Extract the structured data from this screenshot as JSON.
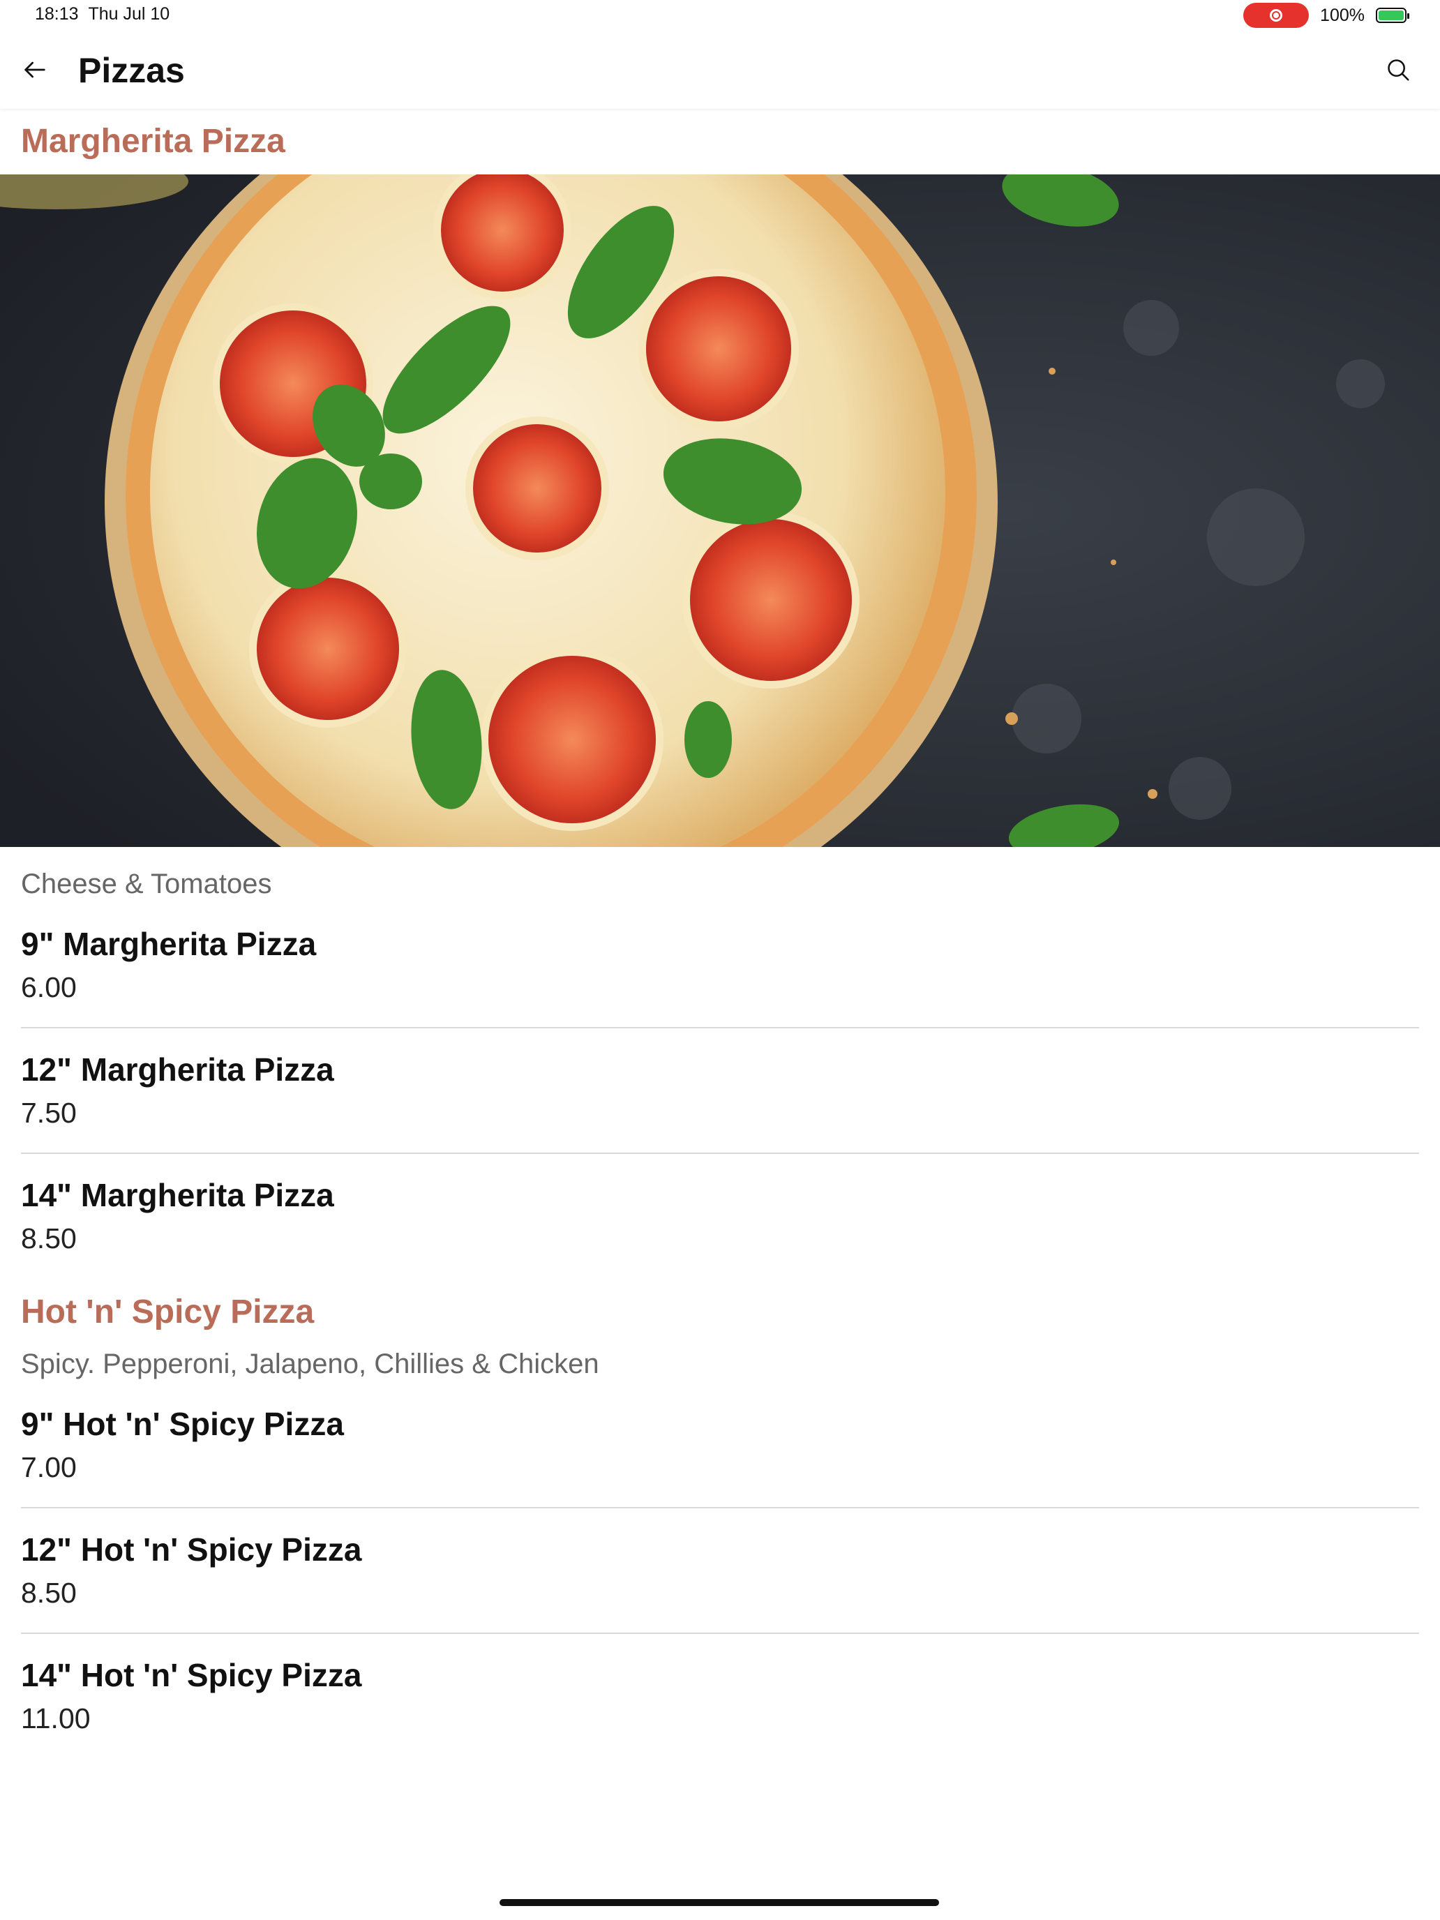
{
  "status_bar": {
    "time": "18:13",
    "date": "Thu Jul 10",
    "battery": "100%",
    "icons": [
      "screen-recording-icon",
      "battery-charging-icon"
    ]
  },
  "app_bar": {
    "title": "Pizzas",
    "back_icon": "arrow-left-icon",
    "search_icon": "search-icon"
  },
  "colors": {
    "accent": "#b96c58",
    "recording": "#e5322d",
    "battery": "#34c759"
  },
  "sections": [
    {
      "title": "Margherita Pizza",
      "image": "margherita-pizza-photo",
      "description": "Cheese & Tomatoes",
      "items": [
        {
          "name": "9\" Margherita Pizza",
          "price": "6.00"
        },
        {
          "name": "12\" Margherita Pizza",
          "price": "7.50"
        },
        {
          "name": "14\" Margherita Pizza",
          "price": "8.50"
        }
      ]
    },
    {
      "title": "Hot 'n' Spicy Pizza",
      "description": "Spicy. Pepperoni, Jalapeno, Chillies & Chicken",
      "items": [
        {
          "name": "9\" Hot 'n' Spicy Pizza",
          "price": "7.00"
        },
        {
          "name": "12\" Hot 'n' Spicy Pizza",
          "price": "8.50"
        },
        {
          "name": "14\" Hot 'n' Spicy Pizza",
          "price": "11.00"
        }
      ]
    }
  ]
}
